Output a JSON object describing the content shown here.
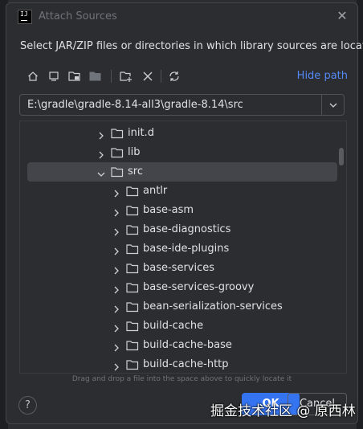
{
  "dialog": {
    "title": "Attach Sources",
    "description": "Select JAR/ZIP files or directories in which library sources are located"
  },
  "toolbar": {
    "hide_path_label": "Hide path",
    "icons": [
      "home-icon",
      "desktop-icon",
      "project-folder-icon",
      "module-folder-icon",
      "new-folder-icon",
      "delete-icon",
      "refresh-icon"
    ]
  },
  "path": {
    "value": "E:\\gradle\\gradle-8.14-all3\\gradle-8.14\\src"
  },
  "tree": {
    "items": [
      {
        "label": "init.d",
        "level": 1,
        "expanded": false,
        "selected": false
      },
      {
        "label": "lib",
        "level": 1,
        "expanded": false,
        "selected": false
      },
      {
        "label": "src",
        "level": 1,
        "expanded": true,
        "selected": true
      },
      {
        "label": "antlr",
        "level": 2,
        "expanded": false,
        "selected": false
      },
      {
        "label": "base-asm",
        "level": 2,
        "expanded": false,
        "selected": false
      },
      {
        "label": "base-diagnostics",
        "level": 2,
        "expanded": false,
        "selected": false
      },
      {
        "label": "base-ide-plugins",
        "level": 2,
        "expanded": false,
        "selected": false
      },
      {
        "label": "base-services",
        "level": 2,
        "expanded": false,
        "selected": false
      },
      {
        "label": "base-services-groovy",
        "level": 2,
        "expanded": false,
        "selected": false
      },
      {
        "label": "bean-serialization-services",
        "level": 2,
        "expanded": false,
        "selected": false
      },
      {
        "label": "build-cache",
        "level": 2,
        "expanded": false,
        "selected": false
      },
      {
        "label": "build-cache-base",
        "level": 2,
        "expanded": false,
        "selected": false
      },
      {
        "label": "build-cache-http",
        "level": 2,
        "expanded": false,
        "selected": false
      }
    ]
  },
  "hint": "Drag and drop a file into the space above to quickly locate it",
  "buttons": {
    "help": "?",
    "ok": "OK",
    "cancel": "Cancel"
  },
  "watermark": "掘金技术社区 @ 原西林",
  "colors": {
    "accent": "#3574f0",
    "link": "#548af7",
    "background": "#2b2d30",
    "selection": "#43454a"
  }
}
